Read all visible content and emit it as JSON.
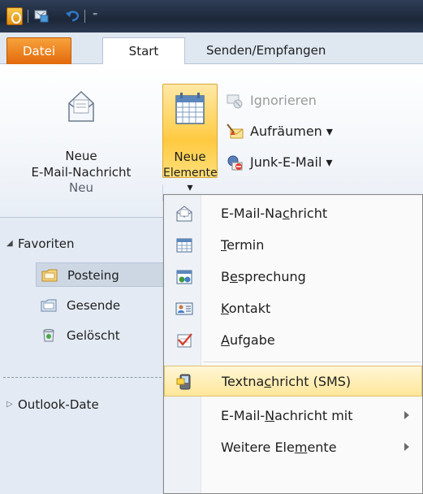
{
  "quick_access": {
    "icons": [
      "outlook-icon",
      "send-receive-icon",
      "undo-icon",
      "customize-toolbar-icon"
    ],
    "more_glyph": "⁼"
  },
  "tabs": [
    {
      "label": "Datei",
      "active": false
    },
    {
      "label": "Start",
      "active": true
    },
    {
      "label": "Senden/Empfangen",
      "active": false
    }
  ],
  "ribbon": {
    "neue_email": {
      "line1": "Neue",
      "line2": "E-Mail-Nachricht"
    },
    "neue_elemente": {
      "line1": "Neue",
      "line2": "Elemente ▾"
    },
    "small_buttons": [
      {
        "label": "Ignorieren",
        "icon": "ignore-icon",
        "enabled": false
      },
      {
        "label": "Aufräumen ▾",
        "icon": "cleanup-icon",
        "enabled": true
      },
      {
        "label": "Junk-E-Mail ▾",
        "icon": "junk-mail-icon",
        "enabled": true
      }
    ],
    "group_label": "Neu"
  },
  "nav": {
    "favoriten": "Favoriten",
    "posteingang": "Posteing",
    "gesendet": "Gesende",
    "geloescht": "Gelöscht",
    "outlook_daten": "Outlook-Date",
    "expanded_glyph": "◢",
    "collapsed_glyph": "▷"
  },
  "menu": {
    "items": [
      {
        "pre": "E-Mail-Na",
        "acc": "c",
        "post": "hricht",
        "icon": "email-message-icon",
        "submenu": false,
        "highlight": false
      },
      {
        "pre": "",
        "acc": "T",
        "post": "ermin",
        "icon": "appointment-icon",
        "submenu": false,
        "highlight": false
      },
      {
        "pre": "B",
        "acc": "e",
        "post": "sprechung",
        "icon": "meeting-icon",
        "submenu": false,
        "highlight": false
      },
      {
        "pre": "",
        "acc": "K",
        "post": "ontakt",
        "icon": "contact-icon",
        "submenu": false,
        "highlight": false
      },
      {
        "pre": "",
        "acc": "A",
        "post": "ufgabe",
        "icon": "task-icon",
        "submenu": false,
        "highlight": false
      },
      {
        "pre": "Textna",
        "acc": "c",
        "post": "hricht (SMS)",
        "icon": "text-message-icon",
        "submenu": false,
        "highlight": true
      },
      {
        "pre": "E-Mail-",
        "acc": "N",
        "post": "achricht mit",
        "icon": "",
        "submenu": true,
        "highlight": false
      },
      {
        "pre": "Weitere Ele",
        "acc": "m",
        "post": "ente",
        "icon": "",
        "submenu": true,
        "highlight": false
      }
    ]
  },
  "colors": {
    "datei_tab": "#e3690a",
    "highlight": "#ffe79a",
    "title_bar": "#1c2738",
    "ribbon_bg": "#f3f6fa"
  }
}
